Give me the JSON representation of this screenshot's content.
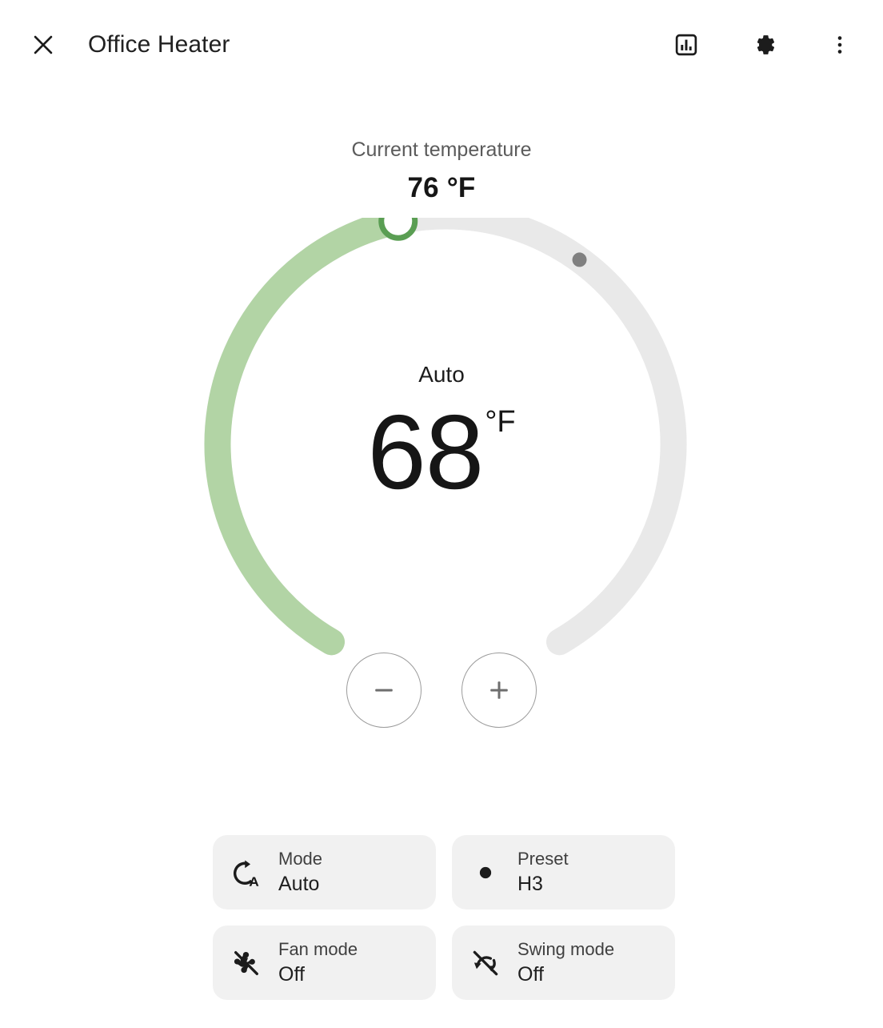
{
  "header": {
    "close_icon": "close-icon",
    "title": "Office Heater",
    "history_icon": "chart-box-icon",
    "settings_icon": "gear-icon",
    "overflow_icon": "dots-vertical-icon"
  },
  "current": {
    "label": "Current temperature",
    "value": "76 °F"
  },
  "dial": {
    "mode_label": "Auto",
    "target_temperature": "68",
    "unit": "°F",
    "decrease_label": "−",
    "increase_label": "+",
    "arc_track_color": "#e9e9e9",
    "arc_active_color": "#b2d4a5",
    "handle_color": "#5a9e53",
    "current_marker_color": "#808080",
    "target_value": 68,
    "current_value": 76,
    "min": 45,
    "max": 95
  },
  "controls": [
    {
      "icon": "thermostat-auto-icon",
      "label": "Mode",
      "value": "Auto"
    },
    {
      "icon": "circle-dot-icon",
      "label": "Preset",
      "value": "H3"
    },
    {
      "icon": "fan-off-icon",
      "label": "Fan mode",
      "value": "Off"
    },
    {
      "icon": "swing-off-icon",
      "label": "Swing mode",
      "value": "Off"
    }
  ]
}
